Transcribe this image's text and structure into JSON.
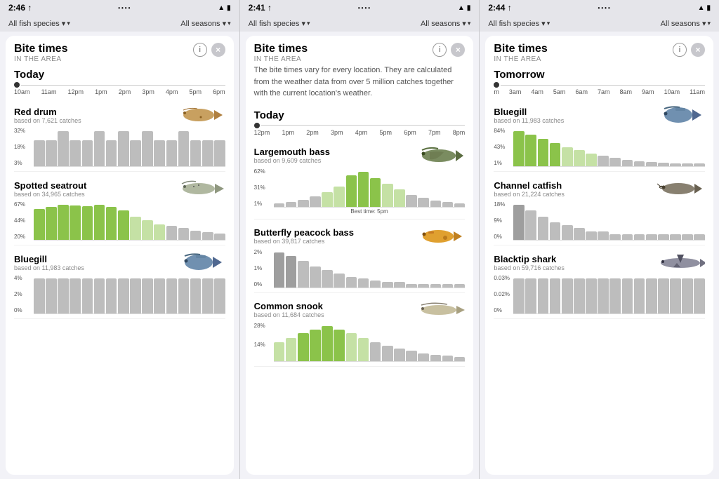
{
  "phones": [
    {
      "id": "phone1",
      "status": {
        "time": "2:46",
        "arrow": "↑",
        "dots": "••••",
        "wifi": "WiFi",
        "battery": "🔋"
      },
      "filters": {
        "species": "All fish species",
        "seasons": "All seasons"
      },
      "panel": {
        "title": "Bite times",
        "subtitle": "IN THE AREA",
        "info_icon": "i",
        "close_icon": "×"
      },
      "day": "Today",
      "timeline": [
        "10am",
        "11am",
        "12pm",
        "1pm",
        "2pm",
        "3pm",
        "4pm",
        "5pm",
        "6pm"
      ],
      "fish": [
        {
          "name": "Red drum",
          "catches": "based on 7,621 catches",
          "pcts": [
            "32%",
            "18%",
            "3%"
          ],
          "bars": [
            3,
            3,
            4,
            3,
            3,
            4,
            3,
            4,
            3,
            4,
            3,
            3,
            4,
            3,
            3,
            3
          ],
          "colors": [
            "gray",
            "gray",
            "gray",
            "gray",
            "gray",
            "gray",
            "gray",
            "gray",
            "gray",
            "gray",
            "gray",
            "gray",
            "gray",
            "gray",
            "gray",
            "gray"
          ],
          "color": "gray"
        },
        {
          "name": "Spotted seatrout",
          "catches": "based on 34,965 catches",
          "pcts": [
            "67%",
            "44%",
            "20%"
          ],
          "bars": [
            40,
            42,
            45,
            44,
            43,
            45,
            42,
            38,
            30,
            25,
            20,
            18,
            15,
            12,
            10,
            8
          ],
          "colors": [
            "green",
            "green",
            "green",
            "green",
            "green",
            "green",
            "green",
            "green",
            "light-green",
            "light-green",
            "light-green",
            "gray",
            "gray",
            "gray",
            "gray",
            "gray"
          ],
          "color": "green"
        },
        {
          "name": "Bluegill",
          "catches": "based on 11,983 catches",
          "pcts": [
            "4%",
            "2%",
            "0%"
          ],
          "bars": [
            2,
            2,
            2,
            2,
            2,
            2,
            2,
            2,
            2,
            2,
            2,
            2,
            2,
            2,
            2,
            2
          ],
          "colors": [
            "gray",
            "gray",
            "gray",
            "gray",
            "gray",
            "gray",
            "gray",
            "gray",
            "gray",
            "gray",
            "gray",
            "gray",
            "gray",
            "gray",
            "gray",
            "gray"
          ],
          "color": "gray"
        }
      ]
    },
    {
      "id": "phone2",
      "status": {
        "time": "2:41",
        "arrow": "↑",
        "dots": "••••",
        "wifi": "WiFi",
        "battery": "🔋"
      },
      "filters": {
        "species": "All fish species",
        "seasons": "All seasons"
      },
      "panel": {
        "title": "Bite times",
        "subtitle": "IN THE AREA",
        "info_icon": "i",
        "close_icon": "×"
      },
      "day": "Today",
      "info_text": "The bite times vary for every location. They are calculated from the weather data from over 5 million catches together with the current location's weather.",
      "timeline": [
        "12pm",
        "1pm",
        "2pm",
        "3pm",
        "4pm",
        "5pm",
        "6pm",
        "7pm",
        "8pm"
      ],
      "fish": [
        {
          "name": "Largemouth bass",
          "catches": "based on 9,609 catches",
          "pcts": [
            "62%",
            "31%",
            "1%"
          ],
          "bars": [
            5,
            8,
            12,
            18,
            25,
            35,
            55,
            62,
            50,
            40,
            30,
            20,
            15,
            10,
            8,
            5
          ],
          "colors": [
            "gray",
            "gray",
            "gray",
            "gray",
            "light-green",
            "light-green",
            "green",
            "green",
            "green",
            "light-green",
            "light-green",
            "gray",
            "gray",
            "gray",
            "gray",
            "gray"
          ],
          "best_time": "Best time: 5pm",
          "color": "green"
        },
        {
          "name": "Butterfly peacock bass",
          "catches": "based on 39,817 catches",
          "pcts": [
            "2%",
            "1%",
            "0%"
          ],
          "bars": [
            20,
            18,
            15,
            12,
            10,
            8,
            6,
            5,
            4,
            3,
            3,
            2,
            2,
            2,
            2,
            2
          ],
          "colors": [
            "dark-gray",
            "dark-gray",
            "gray",
            "gray",
            "gray",
            "gray",
            "gray",
            "gray",
            "gray",
            "gray",
            "gray",
            "gray",
            "gray",
            "gray",
            "gray",
            "gray"
          ],
          "color": "gray"
        },
        {
          "name": "Common snook",
          "catches": "based on 11,684 catches",
          "pcts": [
            "28%",
            "14%",
            ""
          ],
          "bars": [
            15,
            18,
            22,
            25,
            28,
            25,
            22,
            18,
            15,
            12,
            10,
            8,
            6,
            5,
            4,
            3
          ],
          "colors": [
            "light-green",
            "light-green",
            "green",
            "green",
            "green",
            "green",
            "light-green",
            "light-green",
            "gray",
            "gray",
            "gray",
            "gray",
            "gray",
            "gray",
            "gray",
            "gray"
          ],
          "color": "green"
        }
      ]
    },
    {
      "id": "phone3",
      "status": {
        "time": "2:44",
        "arrow": "↑",
        "dots": "••••",
        "wifi": "WiFi",
        "battery": "🔋"
      },
      "filters": {
        "species": "All fish species",
        "seasons": "All seasons"
      },
      "panel": {
        "title": "Bite times",
        "subtitle": "IN THE AREA",
        "info_icon": "i",
        "close_icon": "×"
      },
      "day": "Tomorrow",
      "timeline": [
        "m",
        "3am",
        "4am",
        "5am",
        "6am",
        "7am",
        "8am",
        "9am",
        "10am",
        "11am"
      ],
      "fish": [
        {
          "name": "Bluegill",
          "catches": "based on 11,983 catches",
          "pcts": [
            "84%",
            "43%",
            "1%"
          ],
          "bars": [
            84,
            75,
            65,
            55,
            45,
            38,
            30,
            25,
            20,
            15,
            12,
            10,
            8,
            6,
            5,
            4
          ],
          "colors": [
            "green",
            "green",
            "green",
            "green",
            "light-green",
            "light-green",
            "light-green",
            "gray",
            "gray",
            "gray",
            "gray",
            "gray",
            "gray",
            "gray",
            "gray",
            "gray"
          ],
          "color": "green"
        },
        {
          "name": "Channel catfish",
          "catches": "based on 21,224 catches",
          "pcts": [
            "18%",
            "9%",
            "0%"
          ],
          "bars": [
            12,
            10,
            8,
            6,
            5,
            4,
            3,
            3,
            2,
            2,
            2,
            2,
            2,
            2,
            2,
            2
          ],
          "colors": [
            "dark-gray",
            "gray",
            "gray",
            "gray",
            "gray",
            "gray",
            "gray",
            "gray",
            "gray",
            "gray",
            "gray",
            "gray",
            "gray",
            "gray",
            "gray",
            "gray"
          ],
          "color": "gray"
        },
        {
          "name": "Blacktip shark",
          "catches": "based on 59,716 catches",
          "pcts": [
            "0.03%",
            "0.02%",
            "0%"
          ],
          "bars": [
            2,
            2,
            2,
            2,
            2,
            2,
            2,
            2,
            2,
            2,
            2,
            2,
            2,
            2,
            2,
            2
          ],
          "colors": [
            "gray",
            "gray",
            "gray",
            "gray",
            "gray",
            "gray",
            "gray",
            "gray",
            "gray",
            "gray",
            "gray",
            "gray",
            "gray",
            "gray",
            "gray",
            "gray"
          ],
          "color": "gray"
        }
      ]
    }
  ]
}
